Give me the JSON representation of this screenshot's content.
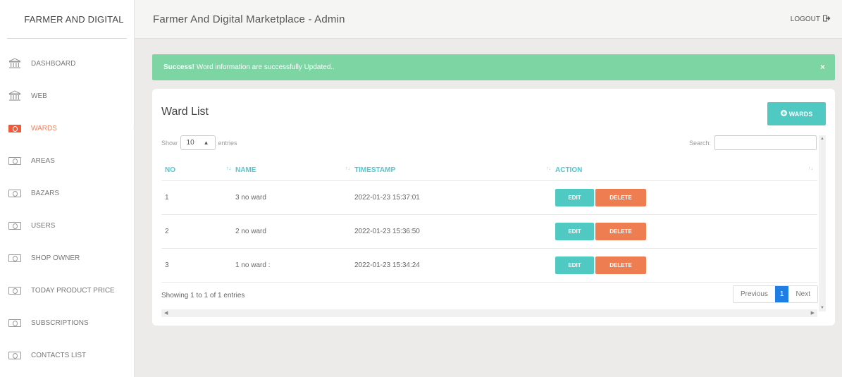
{
  "brand": "FARMER AND DIGITAL",
  "header": {
    "title": "Farmer And Digital Marketplace - Admin",
    "logout": "LOGOUT"
  },
  "sidebar": {
    "items": [
      {
        "label": "DASHBOARD",
        "icon": "bank-icon"
      },
      {
        "label": "WEB",
        "icon": "bank-icon"
      },
      {
        "label": "WARDS",
        "icon": "money-icon",
        "active": true
      },
      {
        "label": "AREAS",
        "icon": "money-icon"
      },
      {
        "label": "BAZARS",
        "icon": "money-icon"
      },
      {
        "label": "USERS",
        "icon": "money-icon"
      },
      {
        "label": "SHOP OWNER",
        "icon": "money-icon"
      },
      {
        "label": "TODAY PRODUCT PRICE",
        "icon": "money-icon"
      },
      {
        "label": "SUBSCRIPTIONS",
        "icon": "money-icon"
      },
      {
        "label": "CONTACTS LIST",
        "icon": "money-icon"
      }
    ]
  },
  "alert": {
    "strong": "Success!",
    "message": "Word information are successfully Updated..",
    "close": "×"
  },
  "card": {
    "title": "Ward List",
    "add_button": "WARDS",
    "show_label": "Show",
    "entries_value": "10",
    "entries_label": "entries",
    "search_label": "Search:",
    "columns": [
      "NO",
      "NAME",
      "TIMESTAMP",
      "ACTION"
    ],
    "rows": [
      {
        "no": "1",
        "name": "3 no ward",
        "timestamp": "2022-01-23 15:37:01"
      },
      {
        "no": "2",
        "name": "2 no ward",
        "timestamp": "2022-01-23 15:36:50"
      },
      {
        "no": "3",
        "name": "1 no ward :",
        "timestamp": "2022-01-23 15:34:24"
      }
    ],
    "edit_label": "EDIT",
    "delete_label": "DELETE",
    "info": "Showing 1 to 1 of 1 entries",
    "pager": {
      "previous": "Previous",
      "current": "1",
      "next": "Next"
    }
  },
  "colors": {
    "accent": "#50c9c3",
    "danger": "#ee7d52",
    "success": "#7dd5a4",
    "active_nav": "#ef7f5a",
    "page_current": "#1f7de6"
  }
}
